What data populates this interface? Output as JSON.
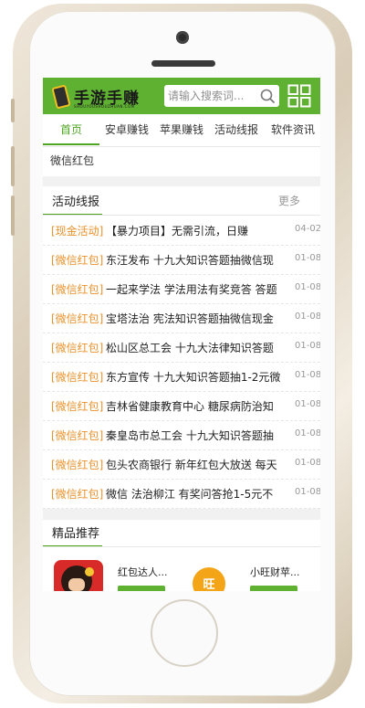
{
  "header": {
    "logo_text": "手游手赚",
    "logo_sub": "SHOUYOUSHOUZHUAN.COM",
    "search_placeholder": "请输入搜索词..."
  },
  "nav": {
    "items": [
      {
        "label": "首页",
        "active": true
      },
      {
        "label": "安卓赚钱"
      },
      {
        "label": "苹果赚钱"
      },
      {
        "label": "活动线报"
      },
      {
        "label": "软件资讯"
      }
    ],
    "row2": [
      {
        "label": "微信红包"
      }
    ]
  },
  "activity": {
    "title": "活动线报",
    "more": "更多",
    "items": [
      {
        "tag": "[现金活动]",
        "title": "【暴力项目】无需引流，日赚",
        "date": "04-02"
      },
      {
        "tag": "[微信红包]",
        "title": "东汪发布 十九大知识答题抽微信现",
        "date": "01-08"
      },
      {
        "tag": "[微信红包]",
        "title": "一起来学法 学法用法有奖竞答 答题",
        "date": "01-08"
      },
      {
        "tag": "[微信红包]",
        "title": "宝塔法治 宪法知识答题抽微信现金",
        "date": "01-08"
      },
      {
        "tag": "[微信红包]",
        "title": "松山区总工会 十九大法律知识答题",
        "date": "01-08"
      },
      {
        "tag": "[微信红包]",
        "title": "东方宣传 十九大知识答题抽1-2元微",
        "date": "01-08"
      },
      {
        "tag": "[微信红包]",
        "title": "吉林省健康教育中心 糖尿病防治知",
        "date": "01-08"
      },
      {
        "tag": "[微信红包]",
        "title": "秦皇岛市总工会 十九大知识答题抽",
        "date": "01-08"
      },
      {
        "tag": "[微信红包]",
        "title": "包头农商银行 新年红包大放送 每天",
        "date": "01-08"
      },
      {
        "tag": "[微信红包]",
        "title": "微信 法治柳江 有奖问答抢1-5元不",
        "date": "01-08"
      }
    ]
  },
  "recommend": {
    "title": "精品推荐",
    "apps": [
      {
        "name": "红包达人...",
        "icon": "red-envelope-app-icon"
      },
      {
        "name": "小旺财苹...",
        "icon": "wang-coin-app-icon",
        "icon_text": "旺"
      }
    ]
  },
  "colors": {
    "brand_green": "#5fb132",
    "tag_orange": "#e8922b"
  }
}
